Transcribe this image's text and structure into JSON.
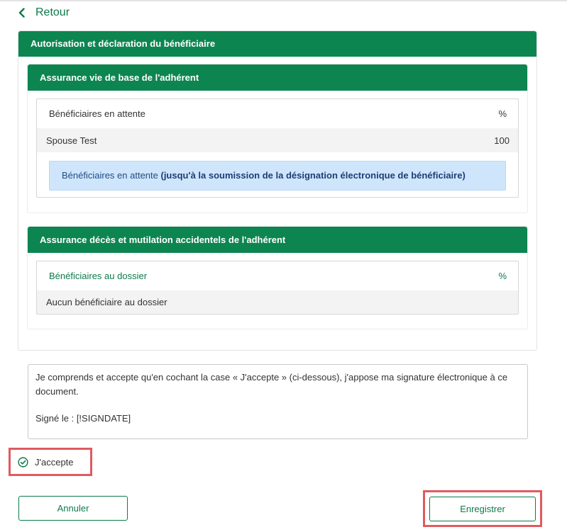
{
  "nav": {
    "back_label": "Retour"
  },
  "main_section": {
    "title": "Autorisation et déclaration du bénéficiaire"
  },
  "basic_life": {
    "title": "Assurance vie de base de l'adhérent",
    "header_label": "Bénéficiaires en attente",
    "header_pct": "%",
    "rows": [
      {
        "name": "Spouse Test",
        "pct": "100"
      }
    ],
    "note_normal": "Bénéficiaires en attente ",
    "note_bold": "(jusqu'à la soumission de la désignation électronique de bénéficiaire)"
  },
  "add_section": {
    "title": "Assurance décès et mutilation accidentels de l'adhérent",
    "header_label": "Bénéficiaires au dossier",
    "header_pct": "%",
    "empty_text": "Aucun bénéficiaire au dossier"
  },
  "legal": {
    "text": "Je comprends et accepte qu'en cochant la case « J'accepte » (ci-dessous), j'appose ma signature électronique à ce document.",
    "signed_label": "Signé le : [!SIGNDATE]"
  },
  "accept": {
    "label": "J'accepte",
    "checked": true
  },
  "actions": {
    "cancel_label": "Annuler",
    "save_label": "Enregistrer"
  },
  "colors": {
    "brand_green": "#0d8550",
    "note_blue": "#cfe5fb",
    "highlight_red": "#e05a5f"
  }
}
